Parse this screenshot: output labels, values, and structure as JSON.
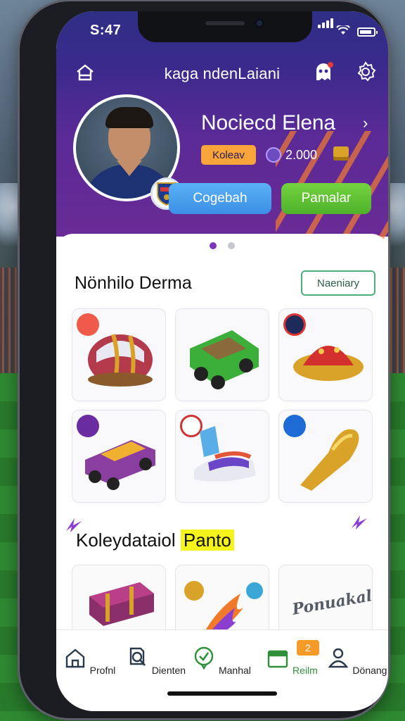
{
  "status_bar": {
    "time": "S:47"
  },
  "header": {
    "title": "kaga ndenLaiani"
  },
  "profile": {
    "name": "Nociecd Elena",
    "tag": "Koleav",
    "coins": "2.000",
    "primary_button": "Cogebah",
    "secondary_button": "Pamalar"
  },
  "carousel": {
    "pages": 2,
    "active": 1
  },
  "section1": {
    "title": "Nönhilo Derma",
    "action": "Naeniary",
    "items": [
      {
        "icon": "helmet-icon"
      },
      {
        "icon": "green-truck-icon"
      },
      {
        "icon": "red-cap-icon"
      },
      {
        "icon": "toy-car-icon"
      },
      {
        "icon": "shoe-icon"
      },
      {
        "icon": "golden-shoe-icon"
      }
    ]
  },
  "section2": {
    "title_plain": "Koleydataiol",
    "title_highlight": "Panto",
    "items": [
      {
        "icon": "treasure-chest-icon"
      },
      {
        "icon": "fireball-icon"
      },
      {
        "text": "Ponuakal"
      }
    ]
  },
  "tabbar": {
    "tabs": [
      {
        "label": "Profnl",
        "icon": "home-icon"
      },
      {
        "label": "Dienten",
        "icon": "search-icon"
      },
      {
        "label": "Manhal",
        "icon": "check-shield-icon"
      },
      {
        "label": "Reilm",
        "icon": "calendar-icon",
        "badge": "2"
      },
      {
        "label": "Dönang",
        "icon": "user-icon"
      }
    ]
  },
  "colors": {
    "accent_purple": "#5a2a96",
    "button_blue": "#3c8fe6",
    "button_green": "#4fb22a",
    "active_tab": "#2f8f3b",
    "highlight": "#f5f31c"
  }
}
